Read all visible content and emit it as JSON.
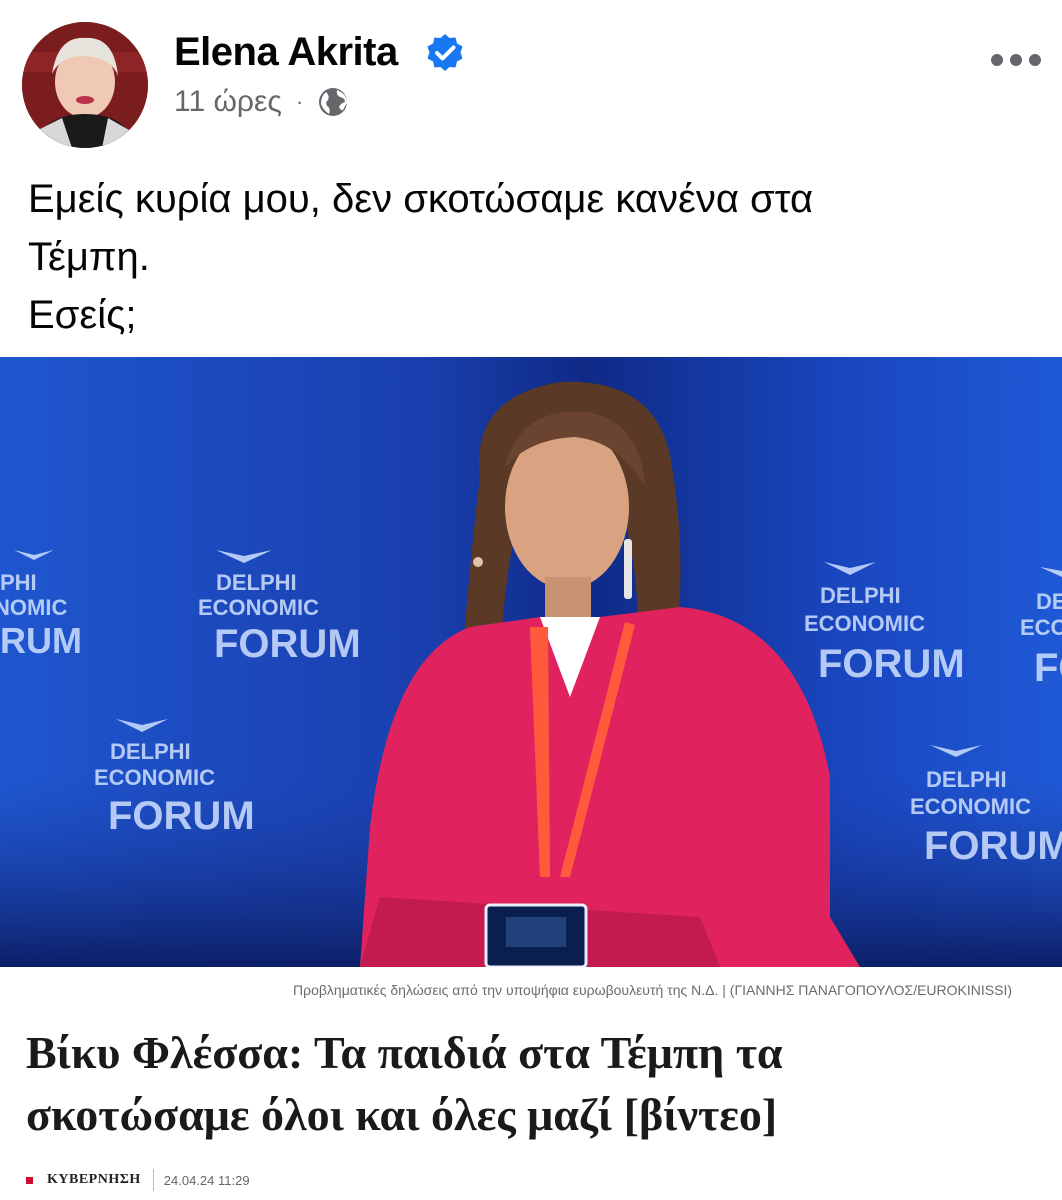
{
  "post": {
    "author": "Elena Akrita",
    "time": "11 ώρες",
    "separator": "·",
    "icons": {
      "verified": "verified-badge-icon",
      "audience": "globe-icon",
      "more": "more-options-icon"
    },
    "text_lines": [
      "Εμείς κυρία μου, δεν σκοτώσαμε κανένα στα",
      "Τέμπη.",
      "Εσείς;"
    ]
  },
  "article": {
    "image_banner_text": "DELPHI ECONOMIC FORUM",
    "caption": "Προβληματικές δηλώσεις από την υποψήφια ευρωβουλευτή της Ν.Δ. | (ΓΙΑΝΝΗΣ ΠΑΝΑΓΟΠΟΥΛΟΣ/EUROKINISSI)",
    "headline_lines": [
      "Βίκυ Φλέσσα: Τα παιδιά στα Τέμπη τα",
      "σκοτώσαμε όλοι και όλες μαζί [βίντεο]"
    ],
    "category": "ΚΥΒΕΡΝΗΣΗ",
    "datetime": "24.04.24 11:29"
  },
  "colors": {
    "verified": "#1877f2",
    "meta_gray": "#65676b",
    "stage_blue": "#1f4fc4",
    "jacket_pink": "#e0235f",
    "category_red": "#c8102e"
  }
}
